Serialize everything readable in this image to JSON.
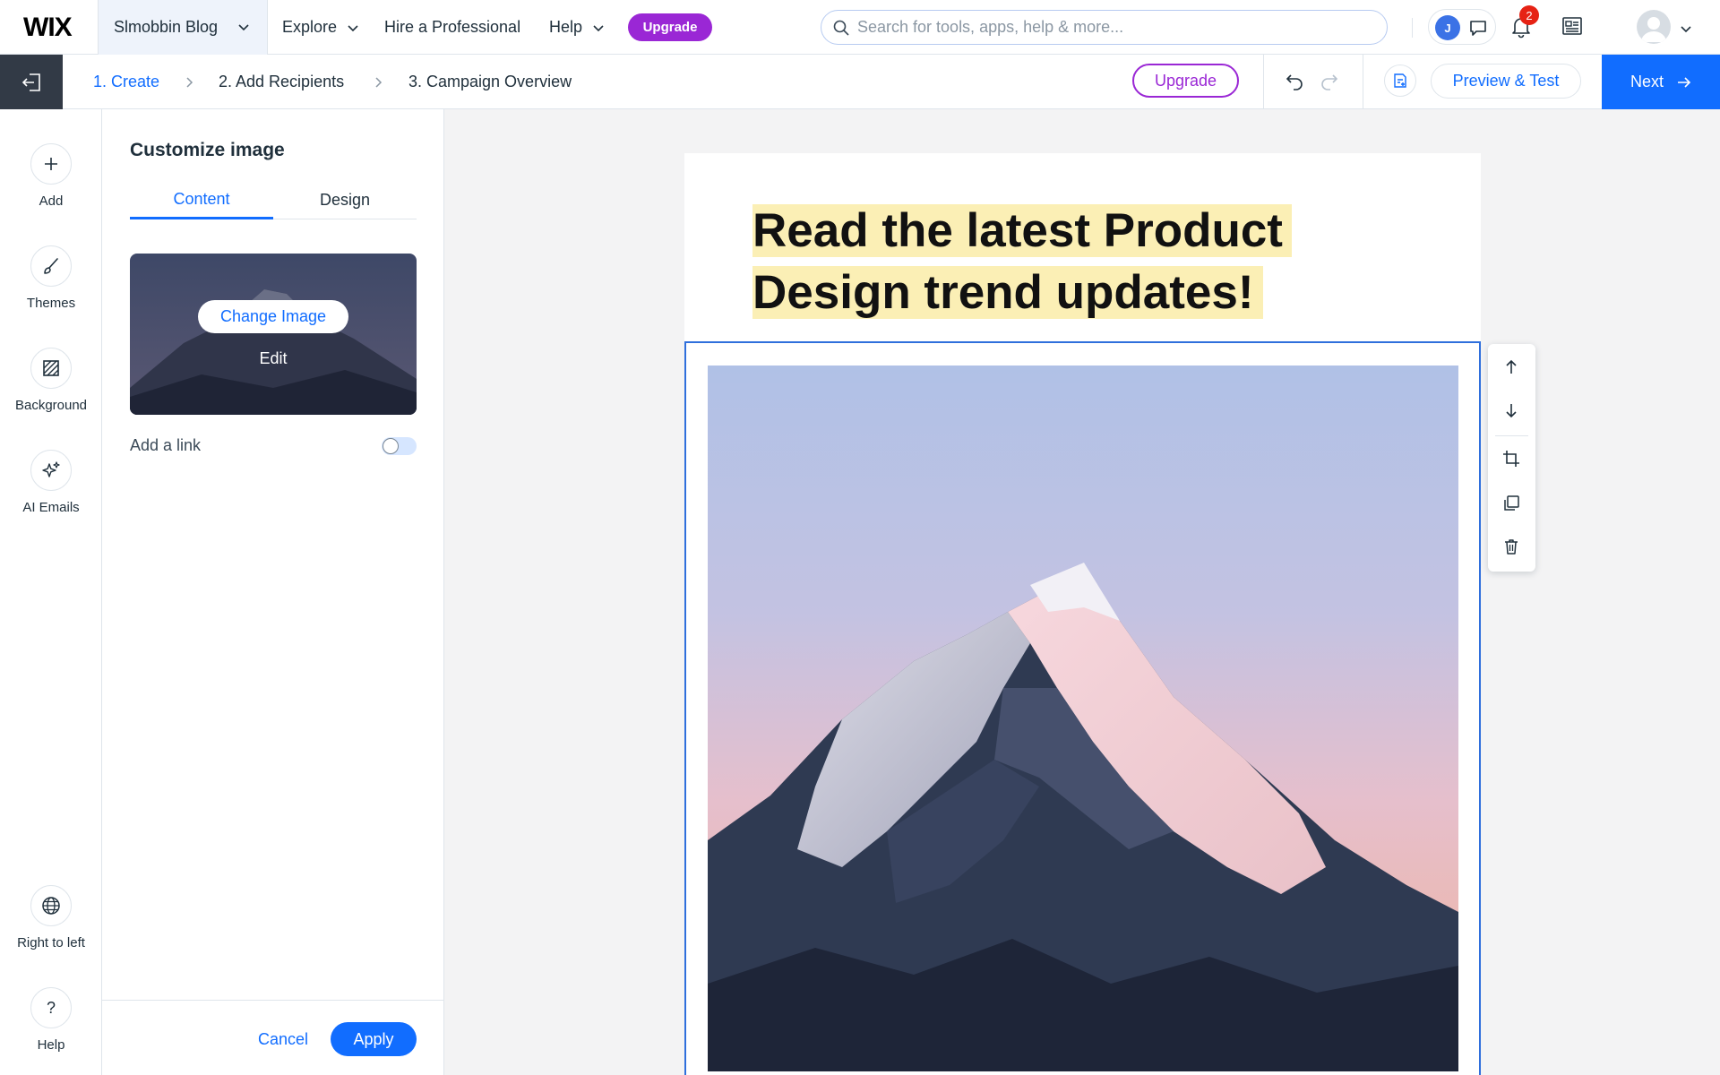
{
  "app": {
    "logo": "WIX"
  },
  "topbar": {
    "site_name": "Slmobbin Blog",
    "nav": {
      "explore": "Explore",
      "hire": "Hire a Professional",
      "help": "Help"
    },
    "upgrade": "Upgrade",
    "search": {
      "placeholder": "Search for tools, apps, help & more..."
    },
    "collab_initial": "J",
    "notification_count": "2"
  },
  "stepbar": {
    "steps": [
      "1. Create",
      "2. Add Recipients",
      "3. Campaign Overview"
    ],
    "active_step": 0,
    "upgrade": "Upgrade",
    "preview": "Preview & Test",
    "next": "Next"
  },
  "rail": {
    "items": [
      {
        "label": "Add",
        "icon": "plus-icon"
      },
      {
        "label": "Themes",
        "icon": "brush-icon"
      },
      {
        "label": "Background",
        "icon": "background-icon"
      },
      {
        "label": "AI Emails",
        "icon": "sparkle-icon"
      }
    ],
    "bottom_items": [
      {
        "label": "Right to left",
        "icon": "globe-icon"
      },
      {
        "label": "Help",
        "icon": "help-icon"
      }
    ]
  },
  "panel": {
    "title": "Customize image",
    "tabs": [
      "Content",
      "Design"
    ],
    "active_tab": 0,
    "change_image": "Change Image",
    "edit": "Edit",
    "add_link_label": "Add a link",
    "add_link_enabled": false,
    "cancel": "Cancel",
    "apply": "Apply"
  },
  "email": {
    "headline": "Read the latest Product Design trend updates!"
  },
  "colors": {
    "accent": "#116dff",
    "upgrade": "#9a27d5",
    "highlight": "#fbefb5",
    "selection": "#2f6fdc"
  }
}
